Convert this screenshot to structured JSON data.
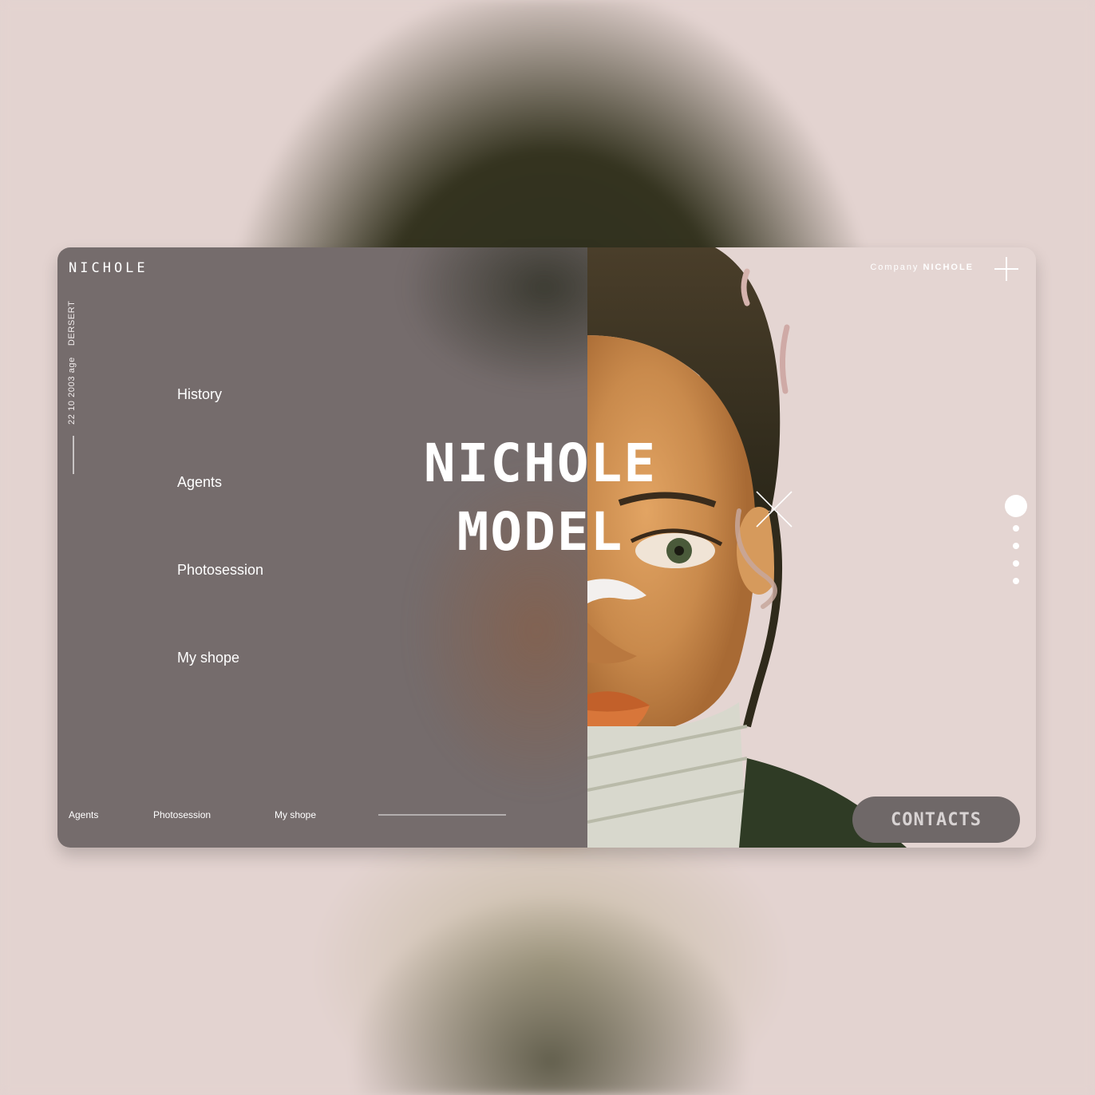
{
  "brand": "NICHOLE",
  "side_info": {
    "dersert": "DERSERT",
    "age": "22 10 2003 age"
  },
  "menu": [
    "History",
    "Agents",
    "Photosession",
    "My shope"
  ],
  "bottom_nav": [
    "Agents",
    "Photosession",
    "My shope"
  ],
  "hero": {
    "line1": "NICHOLE",
    "line2": "MODEL"
  },
  "company": {
    "prefix": "Company",
    "name": "NICHOLE"
  },
  "pagination": {
    "total": 5,
    "active": 1
  },
  "contacts_label": "CONTACTS",
  "colors": {
    "left_panel": "#756c6c",
    "right_panel": "#e4d5d2",
    "backdrop": "#e3d3d0",
    "button": "#6f6868"
  },
  "icons": [
    "plus-icon",
    "close-icon"
  ]
}
